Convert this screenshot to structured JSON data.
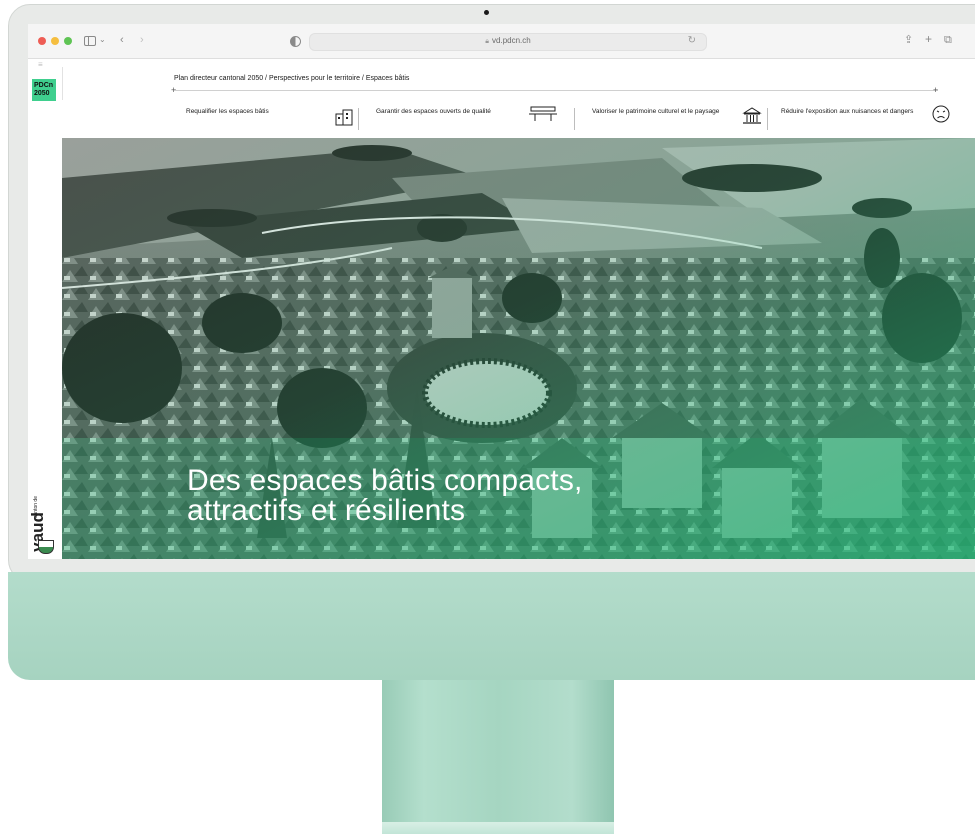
{
  "browser": {
    "url": "vd.pdcn.ch"
  },
  "site": {
    "logo_line1": "PDCn",
    "logo_line2": "2050",
    "canton_small": "canton de",
    "canton_name": "vaud"
  },
  "breadcrumb": "Plan directeur cantonal 2050 / Perspectives pour le territoire / Espaces bâtis",
  "nav": {
    "items": [
      {
        "label": "Requalifier les espaces bâtis",
        "icon": "buildings-icon"
      },
      {
        "label": "Garantir des espaces ouverts de qualité",
        "icon": "bench-icon"
      },
      {
        "label": "Valoriser le patrimoine culturel et le paysage",
        "icon": "monument-icon"
      },
      {
        "label": "Réduire l'exposition aux nuisances et dangers",
        "icon": "sad-face-icon"
      }
    ]
  },
  "hero": {
    "title_line1": "Des espaces bâtis compacts,",
    "title_line2": "attractifs et résilients"
  },
  "colors": {
    "accent_green": "#3fcf8e",
    "imac_green": "#b3dccb"
  }
}
